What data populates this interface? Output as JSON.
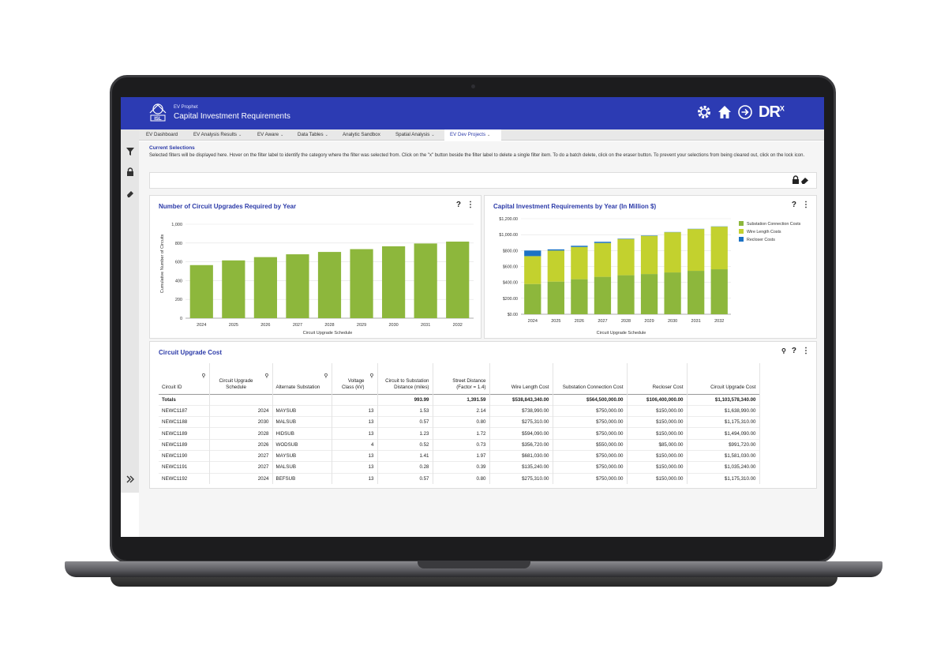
{
  "app": {
    "subtitle": "EV Prophet",
    "title": "Capital Investment Requirements",
    "brand": "DR",
    "brand_sup": "X",
    "header_color": "#2c3bb3"
  },
  "header_icons": [
    "gear-icon",
    "home-icon",
    "logout-icon"
  ],
  "tabs": [
    {
      "label": "EV Dashboard",
      "dropdown": false,
      "active": false
    },
    {
      "label": "EV Analysis Results",
      "dropdown": true,
      "active": false
    },
    {
      "label": "EV Aware",
      "dropdown": true,
      "active": false
    },
    {
      "label": "Data Tables",
      "dropdown": true,
      "active": false
    },
    {
      "label": "Analytic Sandbox",
      "dropdown": false,
      "active": false
    },
    {
      "label": "Spatial Analysis",
      "dropdown": true,
      "active": false
    },
    {
      "label": "EV Dev Projects",
      "dropdown": true,
      "active": true
    }
  ],
  "selections": {
    "title": "Current Selections",
    "text": "Selected filters will be displayed here. Hover on the filter label to identify the category where the filter was selected from. Click on the \"x\" button beside the filter label to delete a single filter item. To do a batch delete, click on the eraser button. To prevent your selections from being cleared out, click on the lock icon."
  },
  "card_tools": {
    "help": "?",
    "menu": "⋮",
    "search": "🔍"
  },
  "chart1": {
    "title": "Number of Circuit Upgrades Required by Year",
    "chart_data": {
      "type": "bar",
      "categories": [
        "2024",
        "2025",
        "2026",
        "2027",
        "2028",
        "2029",
        "2030",
        "2031",
        "2032"
      ],
      "values": [
        565,
        615,
        650,
        680,
        705,
        735,
        765,
        795,
        815
      ],
      "xlabel": "Circuit Upgrade Schedule",
      "ylabel": "Cumulative Number of Circuits",
      "ylim": [
        0,
        1000
      ],
      "yticks": [
        "0",
        "200",
        "400",
        "600",
        "800",
        "1,000"
      ],
      "color": "#8db73c",
      "grid": true
    }
  },
  "chart2": {
    "title": "Capital Investment Requirements by Year (In Million $)",
    "chart_data": {
      "type": "bar",
      "stacked": true,
      "categories": [
        "2024",
        "2025",
        "2026",
        "2027",
        "2028",
        "2029",
        "2030",
        "2031",
        "2032"
      ],
      "series": [
        {
          "name": "Substation Connection Costs",
          "color": "#8db73c",
          "values": [
            380,
            410,
            440,
            470,
            490,
            505,
            525,
            545,
            565
          ]
        },
        {
          "name": "Wire Length Costs",
          "color": "#c3d12e",
          "values": [
            350,
            390,
            405,
            425,
            455,
            480,
            505,
            525,
            535
          ]
        },
        {
          "name": "Recloser Costs",
          "color": "#1c72c4",
          "values": [
            70,
            15,
            15,
            15,
            5,
            5,
            3,
            3,
            3
          ]
        }
      ],
      "xlabel": "Circuit Upgrade Schedule",
      "ylim": [
        0,
        1200
      ],
      "yticks": [
        "$0.00",
        "$200.00",
        "$400.00",
        "$600.00",
        "$800.00",
        "$1,000.00",
        "$1,200.00"
      ],
      "legend": "right",
      "grid": true
    }
  },
  "table": {
    "title": "Circuit Upgrade Cost",
    "columns": [
      {
        "label": "Circuit ID",
        "search": true,
        "align": "l"
      },
      {
        "label": "Circuit Upgrade Schedule",
        "search": true,
        "align": "r"
      },
      {
        "label": "Alternate Substation",
        "search": true,
        "align": "l"
      },
      {
        "label": "Voltage Class (kV)",
        "search": true,
        "align": "r"
      },
      {
        "label": "Circuit to Substation Distance (miles)",
        "search": false,
        "align": "r"
      },
      {
        "label": "Street Distance (Factor = 1.4)",
        "search": false,
        "align": "r"
      },
      {
        "label": "Wire Length Cost",
        "search": false,
        "align": "r"
      },
      {
        "label": "Substation Connection Cost",
        "search": false,
        "align": "r"
      },
      {
        "label": "Recloser Cost",
        "search": false,
        "align": "r"
      },
      {
        "label": "Circuit Upgrade Cost",
        "search": false,
        "align": "r"
      }
    ],
    "totals": [
      "Totals",
      "",
      "",
      "",
      "993.99",
      "1,391.59",
      "$538,843,340.00",
      "$564,500,000.00",
      "$106,400,000.00",
      "$1,103,578,340.00"
    ],
    "rows": [
      [
        "NEWC1187",
        "2024",
        "MAYSUB",
        "13",
        "1.53",
        "2.14",
        "$738,990.00",
        "$750,000.00",
        "$150,000.00",
        "$1,638,990.00"
      ],
      [
        "NEWC1188",
        "2030",
        "MALSUB",
        "13",
        "0.57",
        "0.80",
        "$275,310.00",
        "$750,000.00",
        "$150,000.00",
        "$1,175,310.00"
      ],
      [
        "NEWC1189",
        "2028",
        "HIDSUB",
        "13",
        "1.23",
        "1.72",
        "$594,090.00",
        "$750,000.00",
        "$150,000.00",
        "$1,494,090.00"
      ],
      [
        "NEWC1189",
        "2026",
        "WODSUB",
        "4",
        "0.52",
        "0.73",
        "$356,720.00",
        "$550,000.00",
        "$85,000.00",
        "$991,720.00"
      ],
      [
        "NEWC1190",
        "2027",
        "MAYSUB",
        "13",
        "1.41",
        "1.97",
        "$681,030.00",
        "$750,000.00",
        "$150,000.00",
        "$1,581,030.00"
      ],
      [
        "NEWC1191",
        "2027",
        "MALSUB",
        "13",
        "0.28",
        "0.39",
        "$135,240.00",
        "$750,000.00",
        "$150,000.00",
        "$1,035,240.00"
      ],
      [
        "NEWC1192",
        "2024",
        "BEFSUB",
        "13",
        "0.57",
        "0.80",
        "$275,310.00",
        "$750,000.00",
        "$150,000.00",
        "$1,175,310.00"
      ]
    ]
  }
}
